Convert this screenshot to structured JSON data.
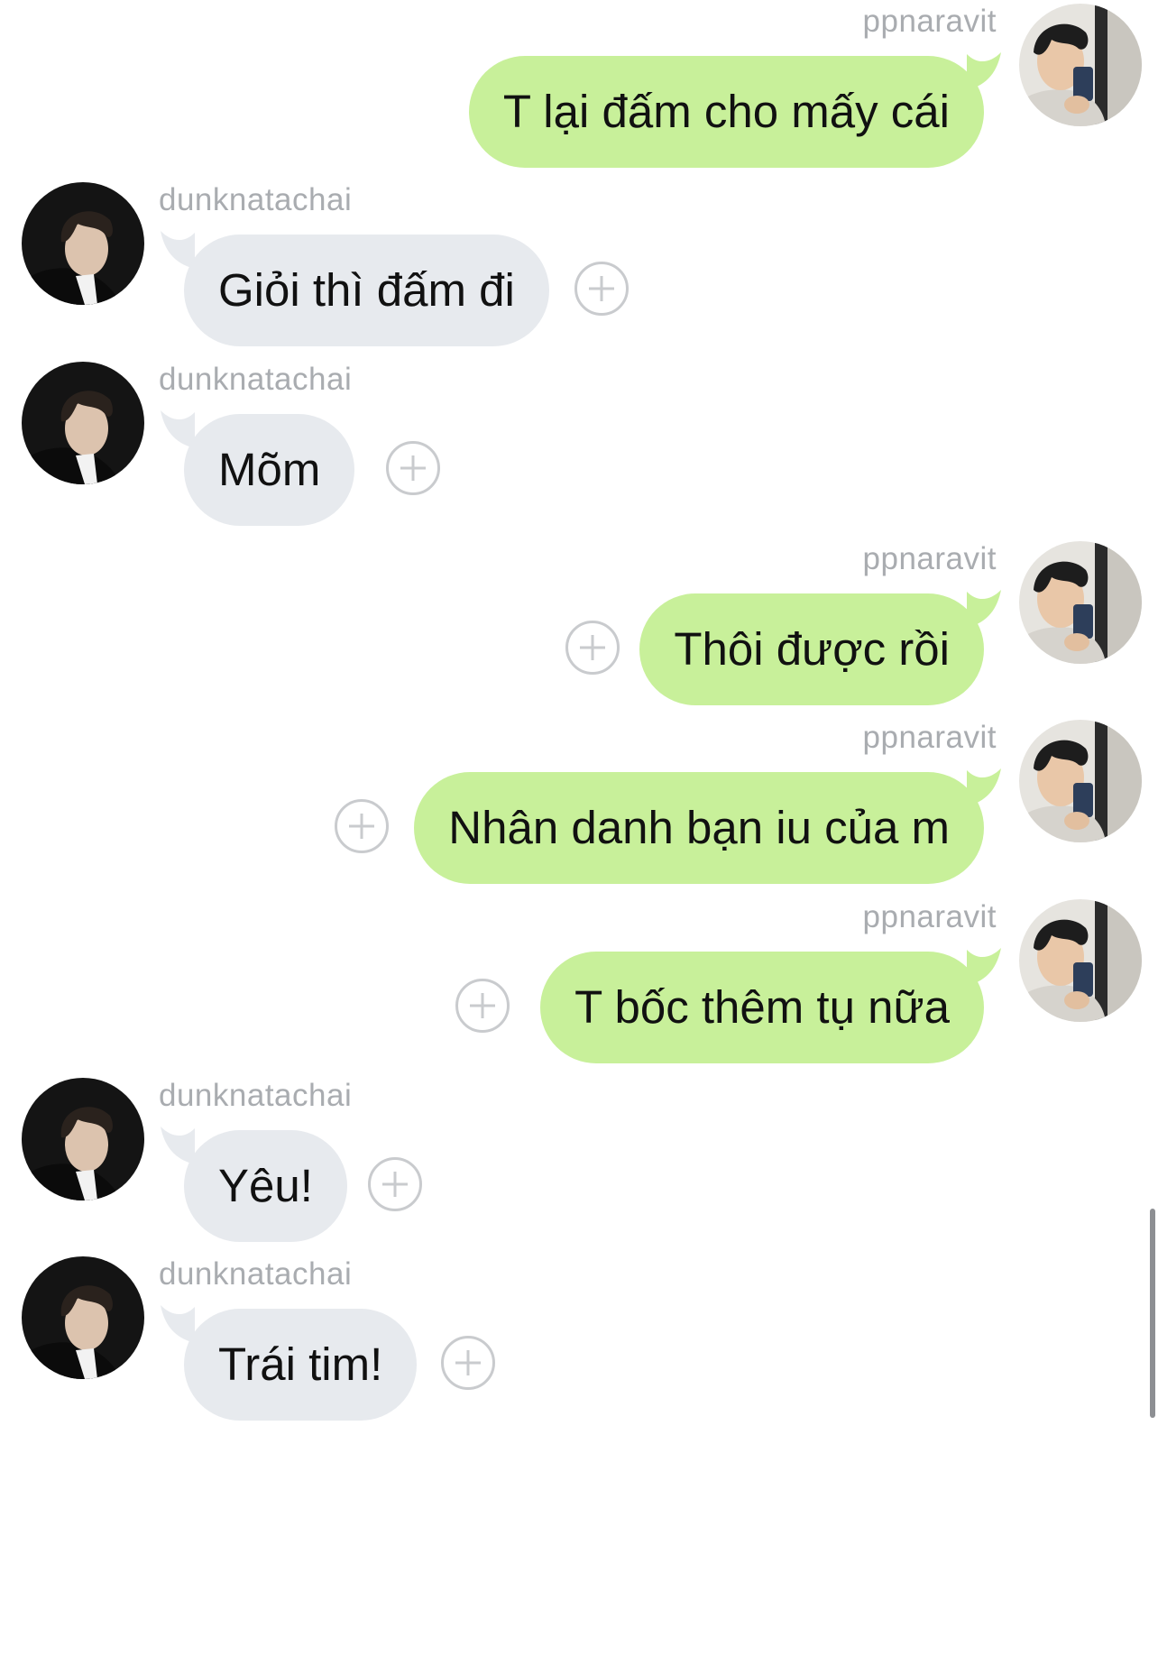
{
  "users": {
    "me": "ppnaravit",
    "them": "dunknatachai"
  },
  "colors": {
    "outgoing_bubble": "#c8f09a",
    "incoming_bubble": "#e7eaee",
    "sender_name": "#a9acb0",
    "react_icon": "#c9cbce"
  },
  "messages": [
    {
      "sender": "ppnaravit",
      "direction": "out",
      "text": "T lại đấm cho mấy cái"
    },
    {
      "sender": "dunknatachai",
      "direction": "in",
      "text": "Giỏi thì đấm đi"
    },
    {
      "sender": "dunknatachai",
      "direction": "in",
      "text": "Mõm"
    },
    {
      "sender": "ppnaravit",
      "direction": "out",
      "text": "Thôi được rồi"
    },
    {
      "sender": "ppnaravit",
      "direction": "out",
      "text": "Nhân danh bạn iu của m"
    },
    {
      "sender": "ppnaravit",
      "direction": "out",
      "text": "T bốc thêm tụ nữa"
    },
    {
      "sender": "dunknatachai",
      "direction": "in",
      "text": "Yêu!"
    },
    {
      "sender": "dunknatachai",
      "direction": "in",
      "text": "Trái tim!"
    }
  ]
}
